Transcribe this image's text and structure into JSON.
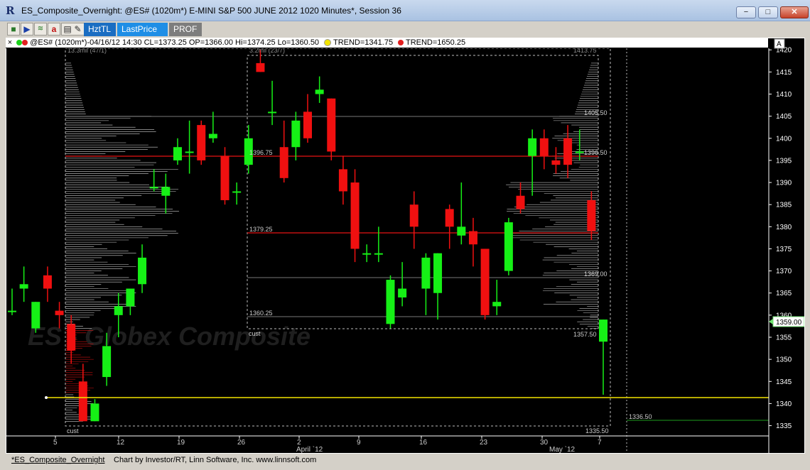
{
  "window": {
    "title": "ES_Composite_Overnight: @ES# (1020m*) E-MINI S&P 500 JUNE 2012 1020 Minutes*, Session 36",
    "minimize": "−",
    "maximize": "□",
    "close": "✕"
  },
  "toolbar": {
    "tabs": [
      {
        "label": "HztTL",
        "color": "#1a6dc2"
      },
      {
        "label": "LastPrice",
        "color": "#1e8ee6"
      },
      {
        "label": "PROF",
        "color": "#7d7d7d"
      }
    ]
  },
  "legend": {
    "close_x": "×",
    "symbol_text": "@ES# (1020m*)-04/16/12 14:30 CL=1373.25 OP=1366.00 Hi=1374.25 Lo=1360.50",
    "trend1": "TREND=1341.75",
    "trend2": "TREND=1650.25",
    "trend1_color": "#f2e400",
    "trend2_color": "#e32020"
  },
  "chart": {
    "watermark": "ES - Globex Composite",
    "price_ticks": [
      "1420",
      "1415",
      "1410",
      "1405",
      "1400",
      "1395",
      "1390",
      "1385",
      "1380",
      "1375",
      "1370",
      "1365",
      "1360",
      "1355",
      "1350",
      "1345",
      "1340",
      "1335"
    ],
    "date_ticks": [
      "5",
      "12",
      "19",
      "26",
      "2",
      "9",
      "16",
      "23",
      "30",
      "7"
    ],
    "month_labels": [
      "April `12",
      "May `12"
    ],
    "last_price": "1359.00",
    "last_price_color": "#6ee06e",
    "scale_button": "A",
    "profile_labels": {
      "left_top": "13.3mil  (47/1)",
      "mid_top": "3.2mil  (23/7)",
      "right_top": "1413.75",
      "level_1405": "1405.50",
      "level_1396": "1396.75",
      "level_1396r": "1396.50",
      "level_1379": "1379.25",
      "level_1369": "1369.00",
      "level_1360": "1360.25",
      "level_1357": "1357.50",
      "level_1336": "1336.50",
      "level_1335": "1335.50",
      "cust1": "cust",
      "cust2": "cust"
    },
    "up_color": "#16f016",
    "down_color": "#f01010",
    "trend_line_value": 1341.75
  },
  "chart_data": {
    "type": "candlestick",
    "y_range": [
      1333,
      1421
    ],
    "candles": [
      {
        "o": 1361,
        "h": 1366,
        "l": 1360,
        "c": 1361
      },
      {
        "o": 1366,
        "h": 1371,
        "l": 1363,
        "c": 1367
      },
      {
        "o": 1357,
        "h": 1363,
        "l": 1356,
        "c": 1363
      },
      {
        "o": 1369,
        "h": 1371,
        "l": 1363,
        "c": 1366
      },
      {
        "o": 1361,
        "h": 1363,
        "l": 1357,
        "c": 1360
      },
      {
        "o": 1358,
        "h": 1360,
        "l": 1349,
        "c": 1352
      },
      {
        "o": 1345,
        "h": 1349,
        "l": 1342,
        "c": 1336
      },
      {
        "o": 1336,
        "h": 1341,
        "l": 1336,
        "c": 1340
      },
      {
        "o": 1346,
        "h": 1356,
        "l": 1344,
        "c": 1353
      },
      {
        "o": 1360,
        "h": 1365,
        "l": 1355,
        "c": 1362
      },
      {
        "o": 1362,
        "h": 1366,
        "l": 1360,
        "c": 1366
      },
      {
        "o": 1367,
        "h": 1376,
        "l": 1365,
        "c": 1373
      },
      {
        "o": 1389,
        "h": 1393,
        "l": 1388,
        "c": 1389
      },
      {
        "o": 1387,
        "h": 1392,
        "l": 1383,
        "c": 1389
      },
      {
        "o": 1395,
        "h": 1400,
        "l": 1394,
        "c": 1398
      },
      {
        "o": 1397,
        "h": 1404,
        "l": 1392,
        "c": 1397
      },
      {
        "o": 1403,
        "h": 1404,
        "l": 1394,
        "c": 1395
      },
      {
        "o": 1400,
        "h": 1406,
        "l": 1399,
        "c": 1401
      },
      {
        "o": 1396,
        "h": 1398,
        "l": 1385,
        "c": 1386
      },
      {
        "o": 1388,
        "h": 1390,
        "l": 1385,
        "c": 1388
      },
      {
        "o": 1394,
        "h": 1403,
        "l": 1392,
        "c": 1400
      },
      {
        "o": 1417,
        "h": 1420,
        "l": 1415,
        "c": 1415
      },
      {
        "o": 1406,
        "h": 1413,
        "l": 1403,
        "c": 1406
      },
      {
        "o": 1398,
        "h": 1404,
        "l": 1390,
        "c": 1391
      },
      {
        "o": 1398,
        "h": 1406,
        "l": 1395,
        "c": 1404
      },
      {
        "o": 1406,
        "h": 1410,
        "l": 1399,
        "c": 1400
      },
      {
        "o": 1410,
        "h": 1414,
        "l": 1408,
        "c": 1411
      },
      {
        "o": 1409,
        "h": 1409,
        "l": 1395,
        "c": 1397
      },
      {
        "o": 1393,
        "h": 1396,
        "l": 1385,
        "c": 1388
      },
      {
        "o": 1390,
        "h": 1393,
        "l": 1372,
        "c": 1375
      },
      {
        "o": 1374,
        "h": 1376,
        "l": 1372,
        "c": 1374
      },
      {
        "o": 1374,
        "h": 1380,
        "l": 1372,
        "c": 1374
      },
      {
        "o": 1358,
        "h": 1369,
        "l": 1357,
        "c": 1368
      },
      {
        "o": 1364,
        "h": 1372,
        "l": 1362,
        "c": 1366
      },
      {
        "o": 1385,
        "h": 1388,
        "l": 1375,
        "c": 1380
      },
      {
        "o": 1366,
        "h": 1374,
        "l": 1360,
        "c": 1373
      },
      {
        "o": 1365,
        "h": 1374,
        "l": 1359,
        "c": 1374
      },
      {
        "o": 1384,
        "h": 1385,
        "l": 1375,
        "c": 1380
      },
      {
        "o": 1378,
        "h": 1390,
        "l": 1376,
        "c": 1380
      },
      {
        "o": 1379,
        "h": 1382,
        "l": 1371,
        "c": 1376
      },
      {
        "o": 1375,
        "h": 1375,
        "l": 1359,
        "c": 1360
      },
      {
        "o": 1362,
        "h": 1368,
        "l": 1360,
        "c": 1363
      },
      {
        "o": 1370,
        "h": 1382,
        "l": 1369,
        "c": 1381
      },
      {
        "o": 1387,
        "h": 1390,
        "l": 1383,
        "c": 1384
      },
      {
        "o": 1396,
        "h": 1402,
        "l": 1387,
        "c": 1400
      },
      {
        "o": 1400,
        "h": 1402,
        "l": 1393,
        "c": 1396
      },
      {
        "o": 1395,
        "h": 1398,
        "l": 1392,
        "c": 1394
      },
      {
        "o": 1400,
        "h": 1403,
        "l": 1391,
        "c": 1394
      },
      {
        "o": 1397,
        "h": 1402,
        "l": 1395,
        "c": 1397
      },
      {
        "o": 1386,
        "h": 1388,
        "l": 1377,
        "c": 1379
      },
      {
        "o": 1354,
        "h": 1359,
        "l": 1342,
        "c": 1359
      }
    ]
  },
  "status": {
    "layout_name": "*ES_Composite_Overnight",
    "credit": "Chart by Investor/RT, Linn Software, Inc. www.linnsoft.com"
  }
}
